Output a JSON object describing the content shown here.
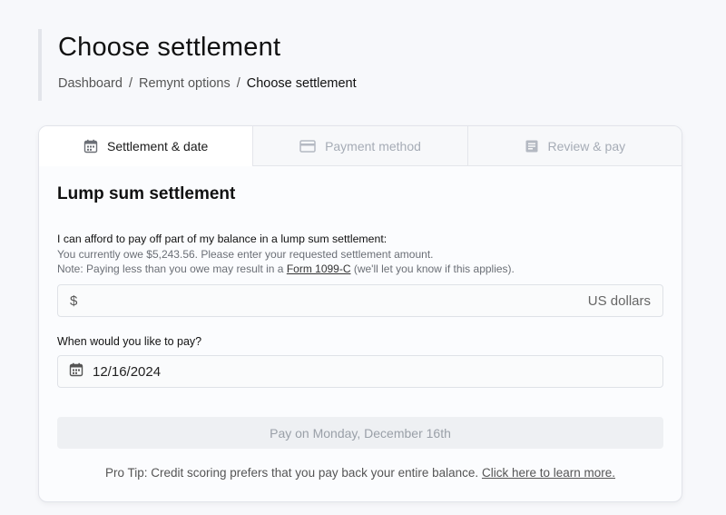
{
  "header": {
    "title": "Choose settlement",
    "breadcrumb": [
      {
        "label": "Dashboard"
      },
      {
        "label": "Remynt options"
      },
      {
        "label": "Choose settlement"
      }
    ],
    "separator": "/"
  },
  "tabs": [
    {
      "label": "Settlement & date",
      "icon": "calendar-icon",
      "active": true
    },
    {
      "label": "Payment method",
      "icon": "credit-card-icon",
      "active": false
    },
    {
      "label": "Review & pay",
      "icon": "document-icon",
      "active": false
    }
  ],
  "form": {
    "section_title": "Lump sum settlement",
    "amount_label": "I can afford to pay off part of my balance in a lump sum settlement:",
    "owe_text": "You currently owe $5,243.56. Please enter your requested settlement amount.",
    "note_prefix": "Note: Paying less than you owe may result in a",
    "note_link": "Form 1099-C",
    "note_suffix": "(we'll let you know if this applies).",
    "amount_prefix": "$",
    "amount_value": "",
    "amount_suffix": "US dollars",
    "date_label": "When would you like to pay?",
    "date_value": "12/16/2024",
    "pay_button": "Pay on Monday, December 16th",
    "pro_tip_text": "Pro Tip: Credit scoring prefers that you pay back your entire balance.",
    "pro_tip_link": "Click here to learn more."
  },
  "colors": {
    "background": "#f7f8fb",
    "inactive_tab_text": "#a6acb6",
    "disabled_button_bg": "#eef0f3",
    "disabled_button_text": "#9aa0a8"
  }
}
